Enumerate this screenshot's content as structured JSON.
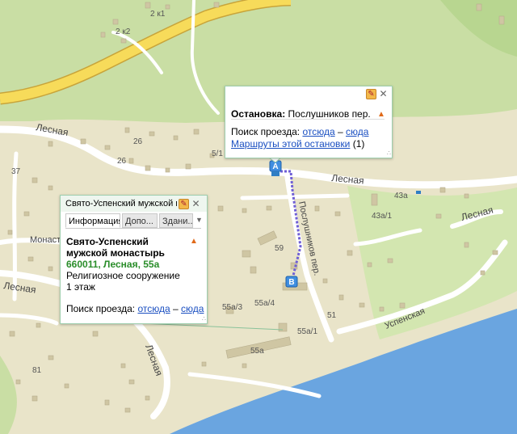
{
  "map": {
    "streets": {
      "lesnaya_top": "Лесная",
      "lesnaya_right": "Лесная",
      "lesnaya_far_right": "Лесная",
      "lesnaya_left": "Лесная",
      "lesnaya_bottom": "Лесная",
      "monastyrskaya": "Монаст",
      "poslushnikov": "Послушников пер.",
      "uspenskaya": "Успенская"
    },
    "house_numbers": [
      "2 к1",
      "2 к2",
      "26",
      "26",
      "5/1",
      "37",
      "43а",
      "43а/1",
      "59",
      "55а/4",
      "55а/3",
      "51",
      "55а/1",
      "55а",
      "81"
    ],
    "markers": {
      "a": "A",
      "b": "B"
    }
  },
  "stop_popup": {
    "title_bold": "Остановка:",
    "title_rest": " Послушников пер.",
    "route_label": "Поиск проезда:",
    "from_here": "отсюда",
    "dash": "–",
    "to_here": "сюда",
    "routes_link": "Маршруты этой остановки",
    "routes_count": "(1)"
  },
  "place_popup": {
    "header": "Свято-Успенский мужской м...",
    "tabs": [
      "Информация",
      "Допо...",
      "Здани..."
    ],
    "name_line1": "Свято-Успенский",
    "name_line2": "мужской монастырь",
    "address": "660011, Лесная, 55а",
    "type": "Религиозное сооружение",
    "floors": "1 этаж",
    "route_label": "Поиск проезда:",
    "from_here": "отсюда",
    "dash": "–",
    "to_here": "сюда"
  },
  "colors": {
    "land": "#e9e4c9",
    "green": "#c9dea4",
    "water": "#6aa5e0",
    "highway": "#f7db5a",
    "popup_border": "#9fcfae",
    "address_green": "#2a8d2a",
    "link": "#1a4fc1"
  }
}
